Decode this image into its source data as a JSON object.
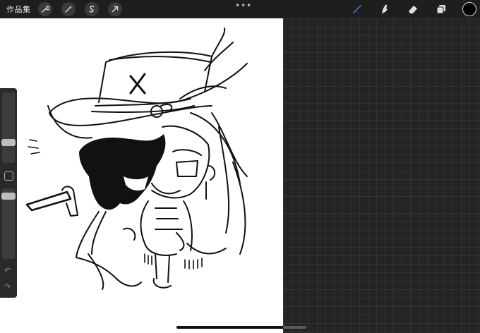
{
  "toolbar": {
    "gallery_label": "作品集",
    "left_tools": [
      "wrench-icon",
      "magic-wand-icon",
      "selection-icon",
      "transform-arrow-icon"
    ],
    "more": "•••",
    "right_tools": [
      "brush-icon",
      "smudge-icon",
      "eraser-icon",
      "layers-icon"
    ],
    "active_tool": "brush",
    "current_color": "#000000",
    "accent": "#3b82f6"
  },
  "sidebar": {
    "size_slider_level": 0.45,
    "opacity_slider_level": 0.05,
    "undo_icon": "undo-arrow-icon",
    "redo_icon": "redo-arrow-icon"
  }
}
